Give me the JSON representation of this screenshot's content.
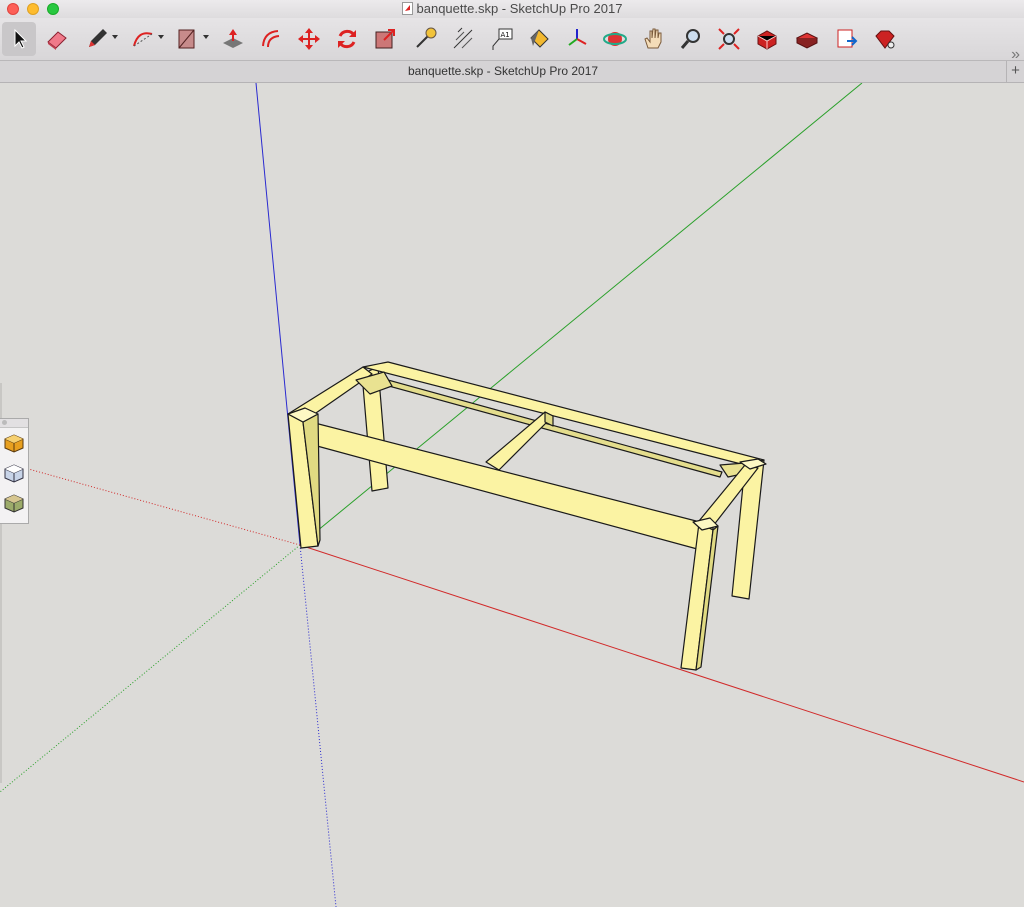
{
  "window": {
    "title": "banquette.skp - SketchUp Pro 2017"
  },
  "tab": {
    "title": "banquette.skp - SketchUp Pro 2017",
    "new_tab_label": "+"
  },
  "toolbar": {
    "overflow_label": "»",
    "tools": [
      "select-icon",
      "eraser-icon",
      "pencil-icon",
      "arc-icon",
      "rectangle-icon",
      "push-pull-icon",
      "offset-icon",
      "move-icon",
      "rotate-icon",
      "scale-icon",
      "tape-measure-icon",
      "dimension-icon",
      "text-icon",
      "paint-bucket-icon",
      "axes-icon",
      "orbit-icon",
      "pan-icon",
      "zoom-icon",
      "zoom-extents-icon",
      "3d-warehouse-icon",
      "extension-warehouse-icon",
      "layout-send-icon",
      "extension-manager-icon"
    ],
    "text_tool_label": "A1"
  },
  "styles_palette": {
    "items": [
      "shaded-style-icon",
      "hidden-line-style-icon",
      "textured-style-icon"
    ]
  },
  "colors": {
    "background": "#dcdbd8",
    "model_face": "#fbf3a3",
    "model_side": "#e0da82",
    "model_edge": "#1a1a1a",
    "axis_red": "#d12a2a",
    "axis_green": "#2aa02a",
    "axis_blue": "#2a2ad0"
  }
}
